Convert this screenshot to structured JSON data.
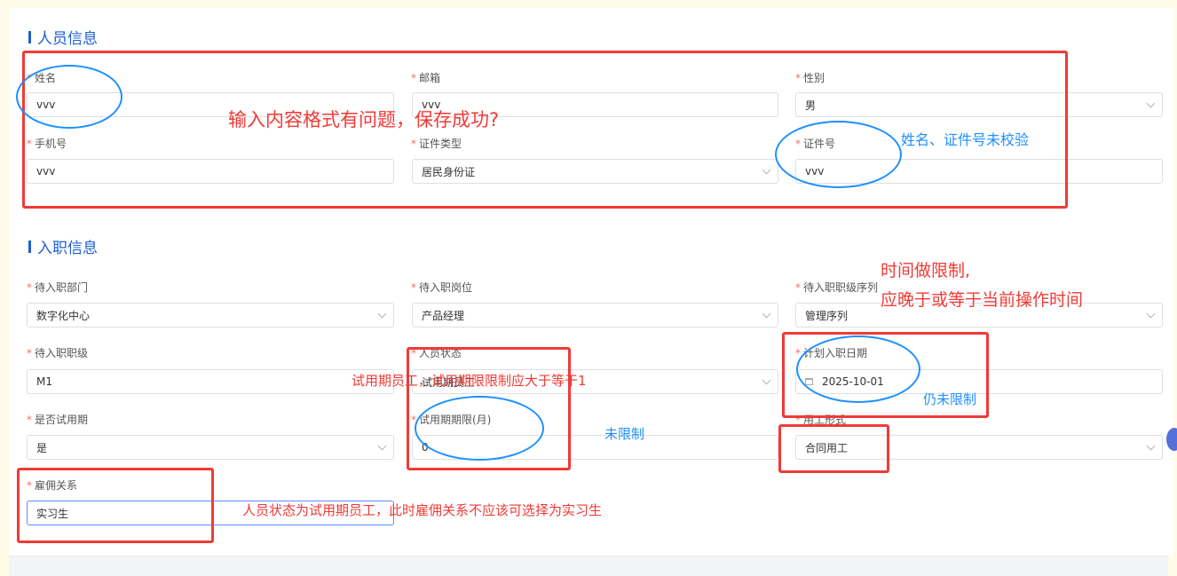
{
  "sections": {
    "personnel": {
      "title": "人员信息"
    },
    "onboarding": {
      "title": "入职信息"
    }
  },
  "personnel_fields": {
    "name": {
      "label": "姓名",
      "value": "vvv"
    },
    "email": {
      "label": "邮箱",
      "value": "vvv"
    },
    "gender": {
      "label": "性别",
      "value": "男"
    },
    "phone": {
      "label": "手机号",
      "value": "vvv"
    },
    "id_type": {
      "label": "证件类型",
      "value": "居民身份证"
    },
    "id_number": {
      "label": "证件号",
      "value": "vvv"
    }
  },
  "onboarding_fields": {
    "department": {
      "label": "待入职部门",
      "value": "数字化中心"
    },
    "position": {
      "label": "待入职岗位",
      "value": "产品经理"
    },
    "grade_sequence": {
      "label": "待入职职级序列",
      "value": "管理序列"
    },
    "grade": {
      "label": "待入职职级",
      "value": "M1"
    },
    "personnel_status": {
      "label": "人员状态",
      "value": "试用期员工"
    },
    "planned_date": {
      "label": "计划入职日期",
      "value": "2025-10-01"
    },
    "has_probation": {
      "label": "是否试用期",
      "value": "是"
    },
    "probation_months": {
      "label": "试用期期限(月)",
      "value": "0"
    },
    "employment_form": {
      "label": "用工形式",
      "value": "合同用工"
    },
    "employment_relation": {
      "label": "雇佣关系",
      "value": "实习生"
    }
  },
  "annotations": {
    "format_issue": "输入内容格式有问题，保存成功?",
    "name_id_not_validated": "姓名、证件号未校验",
    "time_limit_1": "时间做限制,",
    "time_limit_2": "应晚于或等于当前操作时间",
    "probation_limit": "试用期员工，试用期限限制应大于等于1",
    "still_not_limited": "仍未限制",
    "not_limited": "未限制",
    "relation_issue": "人员状态为试用期员工，此时雇佣关系不应该可选择为实习生"
  },
  "colors": {
    "accent": "#1f5fd6",
    "annotation_red": "#ef3b36",
    "annotation_blue": "#1e90ff",
    "required": "#f56c6c"
  }
}
